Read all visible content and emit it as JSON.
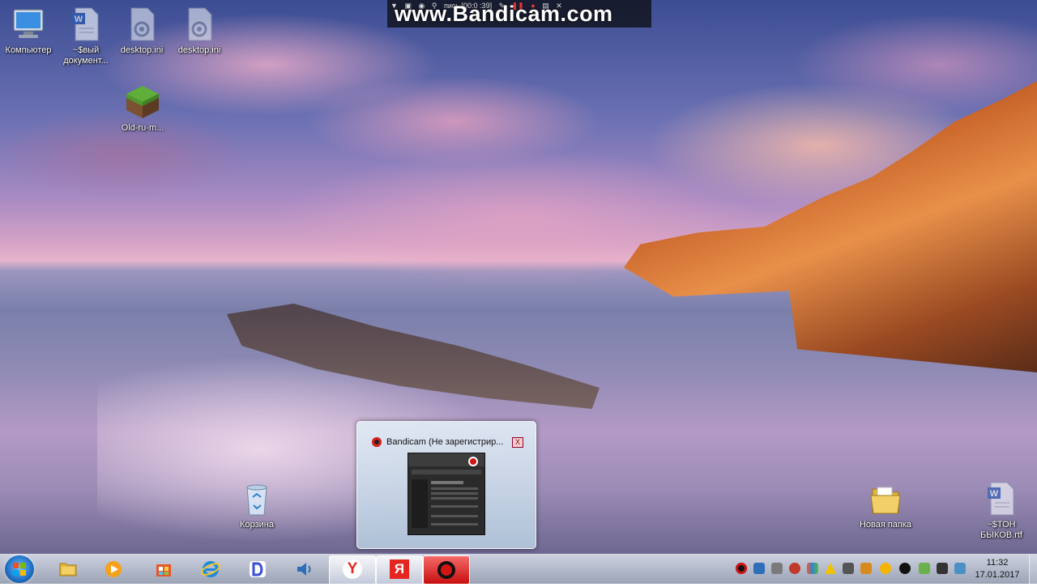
{
  "watermark": {
    "text": "www.Bandicam.com",
    "toolbar_text": "пись [00:0 :39]"
  },
  "desktop": {
    "icons": [
      {
        "label": "Компьютер",
        "icon": "computer-icon"
      },
      {
        "label": "~$вый документ...",
        "icon": "word-document-icon"
      },
      {
        "label": "desktop.ini",
        "icon": "settings-file-icon"
      },
      {
        "label": "desktop.ini",
        "icon": "settings-file-icon"
      },
      {
        "label": "Old-ru-m...",
        "icon": "minecraft-grass-block-icon"
      },
      {
        "label": "Корзина",
        "icon": "recycle-bin-icon"
      },
      {
        "label": "Новая папка",
        "icon": "folder-icon"
      },
      {
        "label": "~$ТОН БЫКОВ.rtf",
        "icon": "word-document-icon"
      }
    ]
  },
  "thumbnail": {
    "title": "Bandicam (Не зарегистрир...",
    "close_glyph": "X"
  },
  "taskbar": {
    "buttons": [
      {
        "icon": "windows-start-icon"
      },
      {
        "icon": "file-explorer-icon"
      },
      {
        "icon": "media-player-icon"
      },
      {
        "icon": "store-icon"
      },
      {
        "icon": "internet-explorer-icon"
      },
      {
        "icon": "d-app-icon"
      },
      {
        "icon": "speaker-icon"
      },
      {
        "icon": "yandex-browser-icon",
        "text": "Y"
      },
      {
        "icon": "yandex-icon",
        "text": "Я"
      },
      {
        "icon": "bandicam-record-icon"
      }
    ],
    "clock": {
      "time": "11:32",
      "date": "17.01.2017"
    }
  },
  "colors": {
    "taskbar": "#a8b0c4",
    "record_red": "#d31414",
    "yandex_red": "#e52620"
  }
}
